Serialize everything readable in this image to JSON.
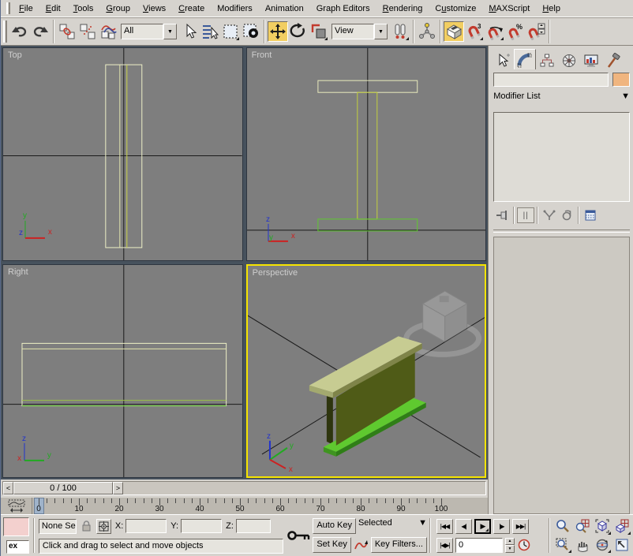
{
  "menu": {
    "items": [
      {
        "label": "File",
        "underline": 0
      },
      {
        "label": "Edit",
        "underline": 0
      },
      {
        "label": "Tools",
        "underline": 0
      },
      {
        "label": "Group",
        "underline": 0
      },
      {
        "label": "Views",
        "underline": 0
      },
      {
        "label": "Create",
        "underline": 0
      },
      {
        "label": "Modifiers",
        "underline": -1
      },
      {
        "label": "Animation",
        "underline": -1
      },
      {
        "label": "Graph Editors",
        "underline": -1
      },
      {
        "label": "Rendering",
        "underline": 0
      },
      {
        "label": "Customize",
        "underline": 1
      },
      {
        "label": "MAXScript",
        "underline": 0
      },
      {
        "label": "Help",
        "underline": 0
      }
    ]
  },
  "toolbar": {
    "selection_filter": "All",
    "coord_system": "View"
  },
  "viewports": {
    "top": {
      "label": "Top"
    },
    "front": {
      "label": "Front"
    },
    "right": {
      "label": "Right"
    },
    "perspective": {
      "label": "Perspective"
    },
    "axis": {
      "x": "x",
      "y": "y",
      "z": "z"
    }
  },
  "command_panel": {
    "object_name_value": "",
    "modifier_list_label": "Modifier List"
  },
  "timeline": {
    "frame_display": "0 / 100",
    "current_frame": 0,
    "ruler_max": 100,
    "tick_labels": [
      0,
      10,
      20,
      30,
      40,
      50,
      60,
      70,
      80,
      90,
      100
    ],
    "slider_left": "<",
    "slider_right": ">"
  },
  "status_bar": {
    "mini_listener_text": "ex",
    "selection_status": "None Se",
    "x_label": "X:",
    "y_label": "Y:",
    "z_label": "Z:",
    "x_value": "",
    "y_value": "",
    "z_value": "",
    "prompt": "Click and drag to select and move objects"
  },
  "animation": {
    "auto_key_label": "Auto Key",
    "set_key_label": "Set Key",
    "key_mode_value": "Selected",
    "key_filters_label": "Key Filters...",
    "frame_number": "0"
  },
  "icons": {
    "dropdown_arrow": "▼",
    "go_start": "|◀◀",
    "prev_frame": "◀|",
    "play": "▶",
    "next_frame": "|▶",
    "go_end": "▶▶|",
    "key_mode": "|◀▶|",
    "spinner_up": "▲",
    "spinner_down": "▼",
    "show_end_result": "||"
  },
  "colors": {
    "chrome": "#d6d3ce",
    "viewport_bg": "#7e7e7e",
    "active_viewport_border": "#f6e400",
    "active_button_bg": "#f2ce62",
    "wire_pale": "#eef0c6",
    "wire_yellow_green": "#c8d24a",
    "wire_green": "#5fc92f",
    "beam_top_face": "#c7cc92",
    "beam_web_face": "#4f5b17",
    "beam_bottom_face": "#5fc92f",
    "object_color_swatch": "#f0b57f",
    "frame_cursor": "#9fb3ca",
    "listener_pink": "#f3d0ce",
    "axis_x": "#cc2222",
    "axis_y": "#22aa22",
    "axis_z": "#2233cc"
  }
}
